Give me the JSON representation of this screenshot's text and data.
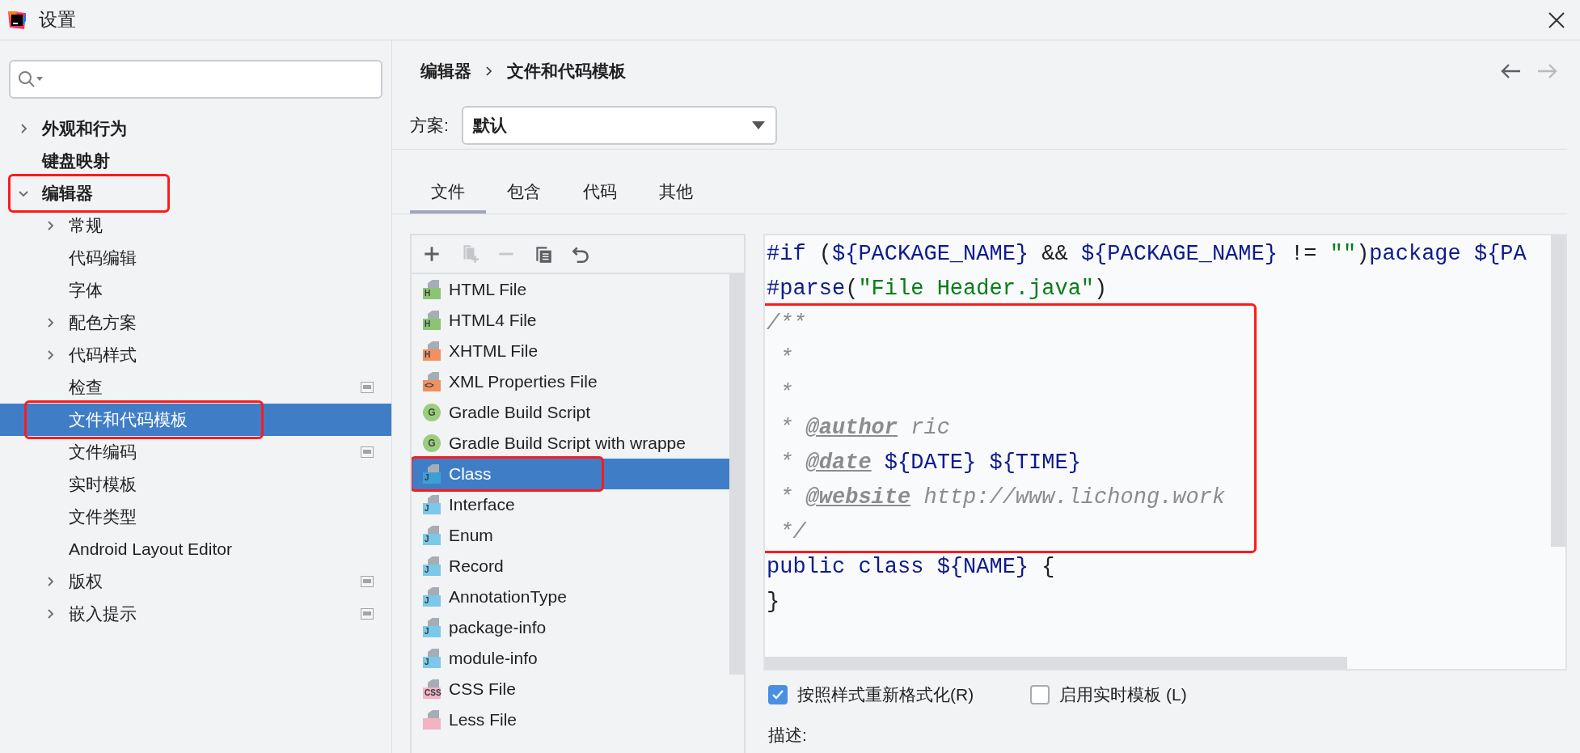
{
  "window": {
    "title": "设置"
  },
  "sidebar": {
    "items": [
      {
        "label": "外观和行为",
        "expanded": false,
        "selected": false,
        "annotated": false,
        "project_icon": false
      },
      {
        "label": "键盘映射",
        "selected": false,
        "annotated": false,
        "project_icon": false
      },
      {
        "label": "编辑器",
        "expanded": true,
        "selected": false,
        "annotated": true,
        "project_icon": false,
        "children": [
          {
            "label": "常规",
            "expanded": false,
            "selected": false,
            "annotated": false,
            "project_icon": false
          },
          {
            "label": "代码编辑",
            "selected": false,
            "annotated": false,
            "project_icon": false
          },
          {
            "label": "字体",
            "selected": false,
            "annotated": false,
            "project_icon": false
          },
          {
            "label": "配色方案",
            "expanded": false,
            "selected": false,
            "annotated": false,
            "project_icon": false
          },
          {
            "label": "代码样式",
            "expanded": false,
            "selected": false,
            "annotated": false,
            "project_icon": false
          },
          {
            "label": "检查",
            "selected": false,
            "annotated": false,
            "project_icon": true
          },
          {
            "label": "文件和代码模板",
            "selected": true,
            "annotated": true,
            "project_icon": false
          },
          {
            "label": "文件编码",
            "selected": false,
            "annotated": false,
            "project_icon": true
          },
          {
            "label": "实时模板",
            "selected": false,
            "annotated": false,
            "project_icon": false
          },
          {
            "label": "文件类型",
            "selected": false,
            "annotated": false,
            "project_icon": false
          },
          {
            "label": "Android Layout Editor",
            "selected": false,
            "annotated": false,
            "project_icon": false
          },
          {
            "label": "版权",
            "expanded": false,
            "selected": false,
            "annotated": false,
            "project_icon": true
          },
          {
            "label": "嵌入提示",
            "expanded": false,
            "selected": false,
            "annotated": false,
            "project_icon": true
          }
        ]
      }
    ]
  },
  "breadcrumb": [
    "编辑器",
    "文件和代码模板"
  ],
  "navigation": {
    "back_disabled": false,
    "forward_disabled": true
  },
  "scheme": {
    "label": "方案:",
    "value": "默认"
  },
  "tabs": [
    {
      "label": "文件",
      "selected": true
    },
    {
      "label": "包含",
      "selected": false
    },
    {
      "label": "代码",
      "selected": false
    },
    {
      "label": "其他",
      "selected": false
    }
  ],
  "toolbar": [
    {
      "kind": "add",
      "disabled": false
    },
    {
      "kind": "copy-add",
      "disabled": true
    },
    {
      "kind": "remove",
      "disabled": true
    },
    {
      "kind": "copy",
      "disabled": false
    },
    {
      "kind": "undo",
      "disabled": false
    }
  ],
  "templates": [
    {
      "name": "HTML File",
      "kind": "file",
      "badge": "H",
      "color": "#8cc571",
      "selected": false,
      "annotated": false
    },
    {
      "name": "HTML4 File",
      "kind": "file",
      "badge": "H",
      "color": "#8cc571",
      "selected": false,
      "annotated": false
    },
    {
      "name": "XHTML File",
      "kind": "file",
      "badge": "H",
      "color": "#f0915f",
      "selected": false,
      "annotated": false
    },
    {
      "name": "XML Properties File",
      "kind": "file",
      "badge": "<>",
      "color": "#f0915f",
      "selected": false,
      "annotated": false
    },
    {
      "name": "Gradle Build Script",
      "kind": "gradle",
      "badge": "G",
      "color": "#9ccc81",
      "selected": false,
      "annotated": false
    },
    {
      "name": "Gradle Build Script with wrappe",
      "kind": "gradle",
      "badge": "G",
      "color": "#9ccc81",
      "selected": false,
      "annotated": false
    },
    {
      "name": "Class",
      "kind": "file",
      "badge": "J",
      "color": "#3d9fd4",
      "selected": true,
      "annotated": true
    },
    {
      "name": "Interface",
      "kind": "file",
      "badge": "J",
      "color": "#7cc8e8",
      "selected": false,
      "annotated": false
    },
    {
      "name": "Enum",
      "kind": "file",
      "badge": "J",
      "color": "#7cc8e8",
      "selected": false,
      "annotated": false
    },
    {
      "name": "Record",
      "kind": "file",
      "badge": "J",
      "color": "#7cc8e8",
      "selected": false,
      "annotated": false
    },
    {
      "name": "AnnotationType",
      "kind": "file",
      "badge": "J",
      "color": "#7cc8e8",
      "selected": false,
      "annotated": false
    },
    {
      "name": "package-info",
      "kind": "file",
      "badge": "J",
      "color": "#7cc8e8",
      "selected": false,
      "annotated": false
    },
    {
      "name": "module-info",
      "kind": "file",
      "badge": "J",
      "color": "#7cc8e8",
      "selected": false,
      "annotated": false
    },
    {
      "name": "CSS File",
      "kind": "file",
      "badge": "CSS",
      "color": "#f4b3c2",
      "selected": false,
      "annotated": false
    },
    {
      "name": "Less File",
      "kind": "file",
      "color": "#f4b3c2",
      "selected": false,
      "annotated": false
    }
  ],
  "code": {
    "blocks": [
      {
        "annotated": false,
        "lines": [
          [
            {
              "text": "#if",
              "kind": "directive"
            },
            {
              "text": " (",
              "kind": "plain"
            },
            {
              "text": "${PACKAGE_NAME}",
              "kind": "var"
            },
            {
              "text": " && ",
              "kind": "plain"
            },
            {
              "text": "${PACKAGE_NAME}",
              "kind": "var"
            },
            {
              "text": " != ",
              "kind": "plain"
            },
            {
              "text": "\"\"",
              "kind": "string"
            },
            {
              "text": ")",
              "kind": "plain"
            },
            {
              "text": "package ",
              "kind": "directive"
            },
            {
              "text": "${PA",
              "kind": "var"
            }
          ],
          [
            {
              "text": "#parse",
              "kind": "directive"
            },
            {
              "text": "(",
              "kind": "plain"
            },
            {
              "text": "\"File Header.java\"",
              "kind": "string"
            },
            {
              "text": ")",
              "kind": "plain"
            }
          ]
        ]
      },
      {
        "annotated": true,
        "lines": [
          [
            {
              "text": "/**",
              "kind": "comment"
            }
          ],
          [
            {
              "text": " *",
              "kind": "comment"
            }
          ],
          [
            {
              "text": " *",
              "kind": "comment"
            }
          ],
          [
            {
              "text": " * ",
              "kind": "comment"
            },
            {
              "text": "@author",
              "kind": "tag"
            },
            {
              "text": " ric",
              "kind": "comment"
            }
          ],
          [
            {
              "text": " * ",
              "kind": "comment"
            },
            {
              "text": "@date",
              "kind": "tag"
            },
            {
              "text": " ${DATE} ${TIME}",
              "kind": "var"
            }
          ],
          [
            {
              "text": " * ",
              "kind": "comment"
            },
            {
              "text": "@website",
              "kind": "tag"
            },
            {
              "text": " http://www.lichong.work",
              "kind": "comment"
            }
          ],
          [
            {
              "text": " */",
              "kind": "comment"
            }
          ]
        ]
      },
      {
        "annotated": false,
        "lines": [
          [
            {
              "text": "public class ",
              "kind": "directive"
            },
            {
              "text": "${NAME}",
              "kind": "var"
            },
            {
              "text": " {",
              "kind": "plain"
            }
          ],
          [
            {
              "text": "}",
              "kind": "plain"
            }
          ]
        ]
      }
    ]
  },
  "options": [
    {
      "label": "按照样式重新格式化(R)",
      "checked": true
    },
    {
      "label": "启用实时模板 (L)",
      "checked": false
    }
  ],
  "description_label": "描述:"
}
